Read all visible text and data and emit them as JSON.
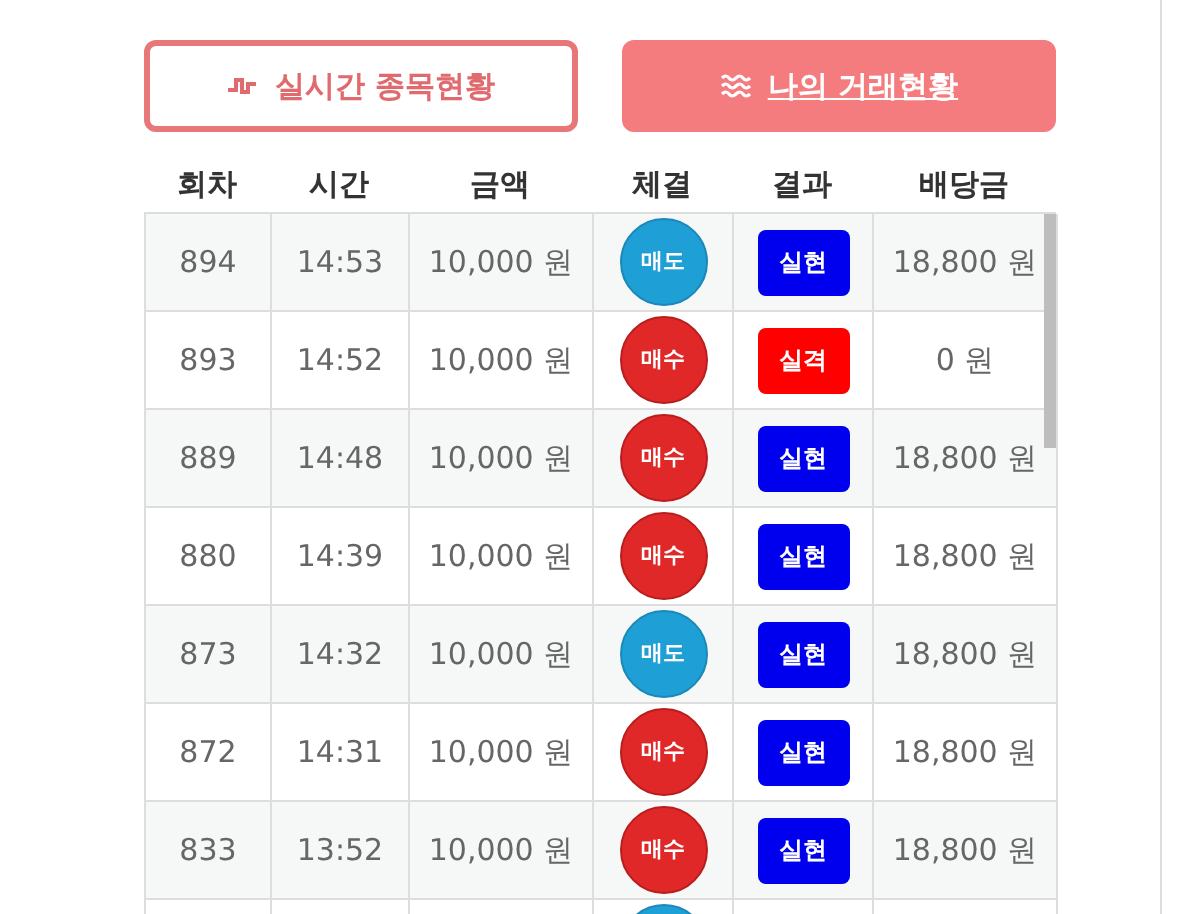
{
  "tabs": [
    {
      "label": "실시간 종목현황",
      "kind": "pulse",
      "selected": false
    },
    {
      "label": "나의 거래현황",
      "kind": "waves",
      "selected": true
    }
  ],
  "table": {
    "columns": [
      "회차",
      "시간",
      "금액",
      "체결",
      "결과",
      "배당금"
    ],
    "rows": [
      {
        "round": "894",
        "time": "14:53",
        "amount": "10,000 원",
        "side": {
          "label": "매도",
          "kind": "sell"
        },
        "result": {
          "label": "실현",
          "kind": "win"
        },
        "payout": "18,800 원"
      },
      {
        "round": "893",
        "time": "14:52",
        "amount": "10,000 원",
        "side": {
          "label": "매수",
          "kind": "buy"
        },
        "result": {
          "label": "실격",
          "kind": "lose"
        },
        "payout": "0 원"
      },
      {
        "round": "889",
        "time": "14:48",
        "amount": "10,000 원",
        "side": {
          "label": "매수",
          "kind": "buy"
        },
        "result": {
          "label": "실현",
          "kind": "win"
        },
        "payout": "18,800 원"
      },
      {
        "round": "880",
        "time": "14:39",
        "amount": "10,000 원",
        "side": {
          "label": "매수",
          "kind": "buy"
        },
        "result": {
          "label": "실현",
          "kind": "win"
        },
        "payout": "18,800 원"
      },
      {
        "round": "873",
        "time": "14:32",
        "amount": "10,000 원",
        "side": {
          "label": "매도",
          "kind": "sell"
        },
        "result": {
          "label": "실현",
          "kind": "win"
        },
        "payout": "18,800 원"
      },
      {
        "round": "872",
        "time": "14:31",
        "amount": "10,000 원",
        "side": {
          "label": "매수",
          "kind": "buy"
        },
        "result": {
          "label": "실현",
          "kind": "win"
        },
        "payout": "18,800 원"
      },
      {
        "round": "833",
        "time": "13:52",
        "amount": "10,000 원",
        "side": {
          "label": "매수",
          "kind": "buy"
        },
        "result": {
          "label": "실현",
          "kind": "win"
        },
        "payout": "18,800 원"
      },
      {
        "side": {
          "kind": "sell"
        }
      }
    ]
  }
}
